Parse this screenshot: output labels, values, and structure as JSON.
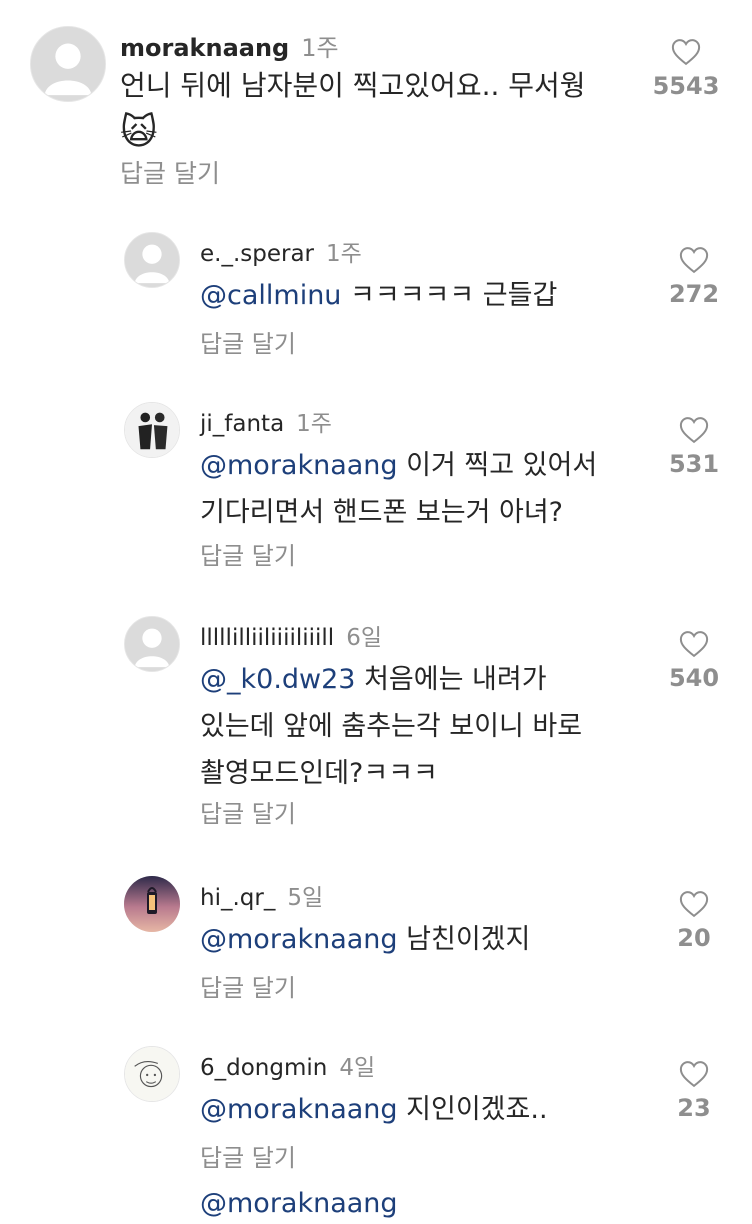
{
  "comments": [
    {
      "username": "moraknaang",
      "time": "1주",
      "mention": "",
      "text": "언니 뒤에 남자분이 찍고있어요.. 무서웡",
      "emoji": "🙀",
      "reply": "답글 달기",
      "likes": "5543"
    },
    {
      "username": "e._.sperar",
      "time": "1주",
      "mention": "@callminu",
      "text": "ㅋㅋㅋㅋㅋ 근들갑",
      "reply": "답글 달기",
      "likes": "272"
    },
    {
      "username": "ji_fanta",
      "time": "1주",
      "mention": "@moraknaang",
      "text": "이거 찍고 있어서",
      "text2": "기다리면서 핸드폰 보는거 아녀?",
      "reply": "답글 달기",
      "likes": "531"
    },
    {
      "username": "lllllilliiliiiiliiill",
      "time": "6일",
      "mention": "@_k0.dw23",
      "text": "처음에는 내려가",
      "text2": "있는데 앞에 춤추는각 보이니 바로",
      "text3": "촬영모드인데?ㅋㅋㅋ",
      "reply": "답글 달기",
      "likes": "540"
    },
    {
      "username": "hi_.qr_",
      "time": "5일",
      "mention": "@moraknaang",
      "text": "남친이겠지",
      "reply": "답글 달기",
      "likes": "20"
    },
    {
      "username": "6_dongmin",
      "time": "4일",
      "mention": "@moraknaang",
      "text": "지인이겠죠..",
      "reply": "답글 달기",
      "likes": "23"
    }
  ],
  "partial_next": "@moraknaang"
}
